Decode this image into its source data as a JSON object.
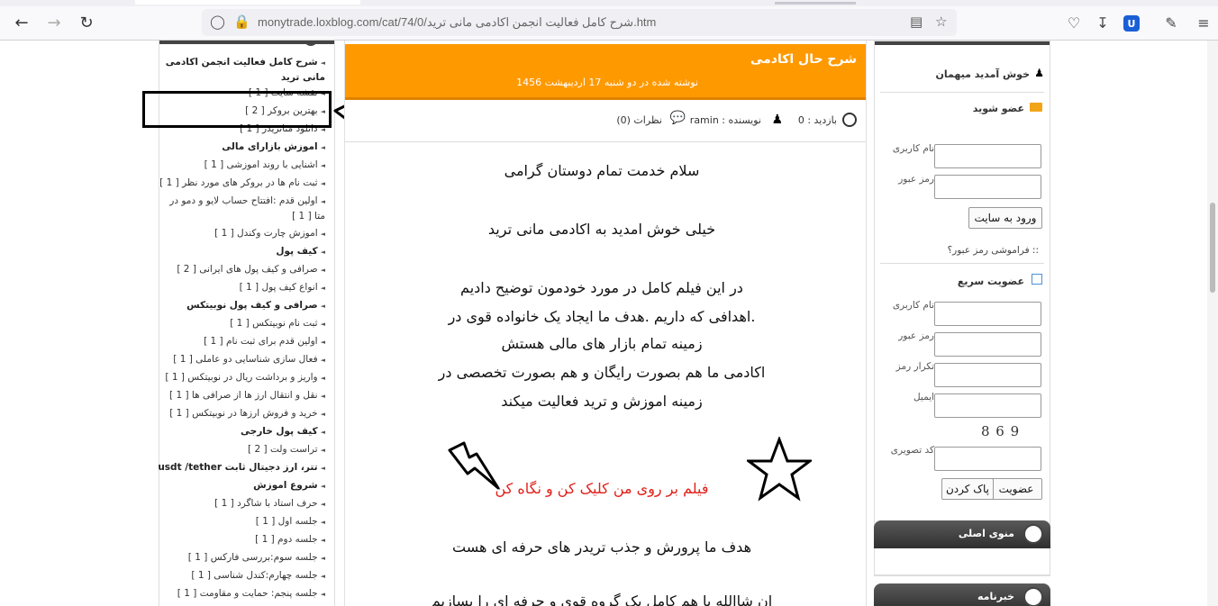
{
  "browser": {
    "url": "monytrade.loxblog.com/cat/74/0/شرح کامل فعالیت انجمن اکادمی مانی ترید.htm",
    "back_icon": "arrow-left-icon",
    "forward_icon": "arrow-right-icon",
    "reload_icon": "reload-icon"
  },
  "left_sidebar": {
    "items": [
      {
        "label": "شرح کامل فعالیت انجمن اکادمی مانی ترید",
        "bold": true
      },
      {
        "label": "نقشه سایت [ 1 ]"
      },
      {
        "label": "بهترین بروکر [ 2 ]"
      },
      {
        "label": "دانلود متاتریدر [ 1 ]"
      },
      {
        "label": "اموزش بازارای مالی",
        "bold": true
      },
      {
        "label": "اشنایی با روند اموزشی [ 1 ]"
      },
      {
        "label": "ثبت نام ها در بروکر های مورد نظر [ 1 ]"
      },
      {
        "label": "اولین قدم :افتتاح حساب لایو و دمو در متا [ 1 ]"
      },
      {
        "label": "اموزش چارت وکندل [ 1 ]"
      },
      {
        "label": "کیف پول",
        "bold": true
      },
      {
        "label": "صرافی و کیف پول های ایرانی [ 2 ]"
      },
      {
        "label": "انواع کیف پول [ 1 ]"
      },
      {
        "label": "صرافی و کیف پول نوبیتکس",
        "bold": true
      },
      {
        "label": "ثبت نام نوبیتکس [ 1 ]"
      },
      {
        "label": "اولین قدم برای ثبت نام [ 1 ]"
      },
      {
        "label": "فعال سازی شناسایی دو عاملی [ 1 ]"
      },
      {
        "label": "واریز و برداشت ریال در نوبیتکس [ 1 ]"
      },
      {
        "label": "نقل و انتقال ارز ها از صرافی ها [ 1 ]"
      },
      {
        "label": "خرید و فروش ارزها در نوبیتکس [ 1 ]"
      },
      {
        "label": "کیف پول خارجی",
        "bold": true
      },
      {
        "label": "تراست ولت [ 2 ]"
      },
      {
        "label": "تتر، ارز دجیتال ثابت usdt /tether",
        "bold": true
      },
      {
        "label": "شروع اموزش",
        "bold": true
      },
      {
        "label": "حرف استاد با شاگرد [ 1 ]"
      },
      {
        "label": "جلسه اول [ 1 ]"
      },
      {
        "label": "جلسه دوم [ 1 ]"
      },
      {
        "label": "جلسه سوم:بررسی فارکس [ 1 ]"
      },
      {
        "label": "جلسه چهارم:کندل شناسی [ 1 ]"
      },
      {
        "label": "جلسه پنجم: حمایت و مقاومت [ 1 ]"
      }
    ]
  },
  "post": {
    "title": "شرح حال اکادمی",
    "date": "نوشته شده در دو شنبه 17 اردیبهشت 1456",
    "visits": "بازدید : 0",
    "author": "نویسنده : ramin",
    "comments": "نظرات (0)",
    "lines": {
      "l1": "سلام خدمت تمام دوستان گرامی",
      "l2": "خیلی خوش امدید به اکادمی مانی ترید",
      "l3": "در این فیلم کامل در مورد خودمون توضیح دادیم",
      "l4": ".اهدافی که داریم .هدف ما ایجاد یک خانواده قوی در",
      "l5": "زمینه تمام بازار های مالی هستش",
      "l6": "اکادمی ما هم بصورت رایگان و هم بصورت تخصصی در",
      "l7": "زمینه اموزش و ترید فعالیت میکند",
      "video_link": "فیلم بر روی من کلیک کن و نگاه کن",
      "l8": "هدف ما پرورش و جذب تریدر های حرفه ای هست",
      "l9": "ان شاالله با هم کامل یک گروه قوی و حرفه ای را بسازیم"
    }
  },
  "right_sidebar": {
    "welcome": "خوش آمدید میهمان",
    "join_title": "عضو شوید",
    "username_label": "نام کاربری",
    "password_label": "رمز عبور",
    "login_button": "ورود به سایت",
    "forgot": ":: فراموشی رمز عبور؟",
    "quick_title": "عضویت سریع",
    "q_username": "نام کاربری",
    "q_password": "رمز عبور",
    "q_repeat": "تکرار رمز",
    "q_email": "ایمیل",
    "captcha": "8 6 9",
    "captcha_label": "کد تصویری",
    "join_button": "عضویت",
    "clear_button": "پاک کردن",
    "main_menu": "منوی اصلی",
    "newsletter": "خبرنامه"
  }
}
